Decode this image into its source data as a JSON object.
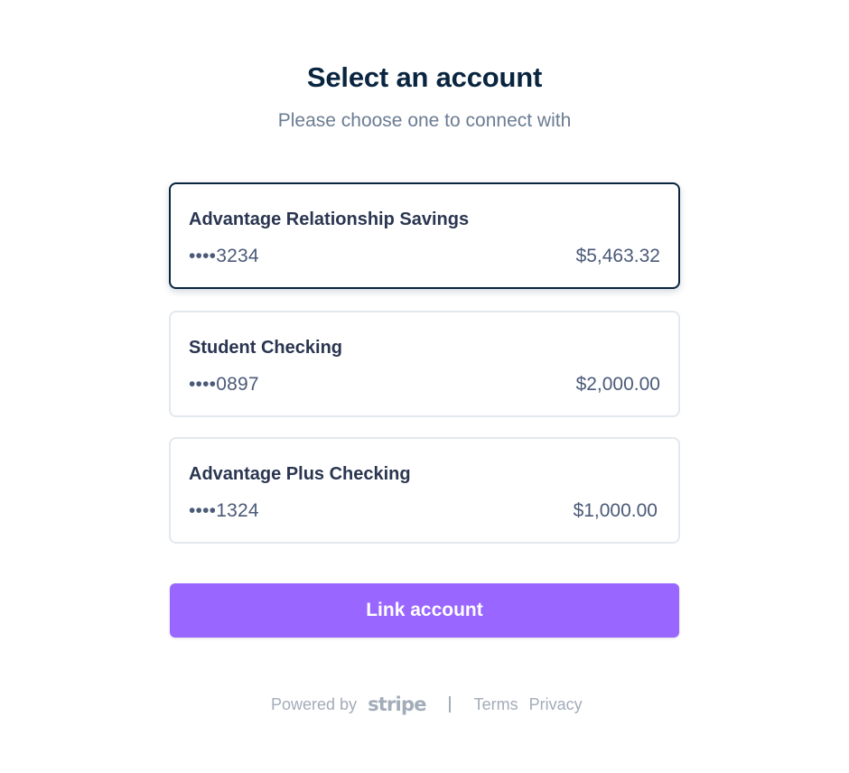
{
  "header": {
    "title": "Select an account",
    "subtitle": "Please choose one to connect with"
  },
  "accounts": [
    {
      "name": "Advantage Relationship Savings",
      "mask": "••••3234",
      "balance": "$5,463.32",
      "selected": true
    },
    {
      "name": "Student Checking",
      "mask": "••••0897",
      "balance": "$2,000.00",
      "selected": false
    },
    {
      "name": "Advantage Plus Checking",
      "mask": "••••1324",
      "balance": "$1,000.00",
      "selected": false
    }
  ],
  "actions": {
    "link_label": "Link account"
  },
  "footer": {
    "powered_by": "Powered by",
    "brand": "stripe",
    "terms": "Terms",
    "privacy": "Privacy"
  },
  "colors": {
    "primary_button": "#9966ff",
    "selected_border": "#0a2540",
    "muted_text": "#a3acb9"
  }
}
